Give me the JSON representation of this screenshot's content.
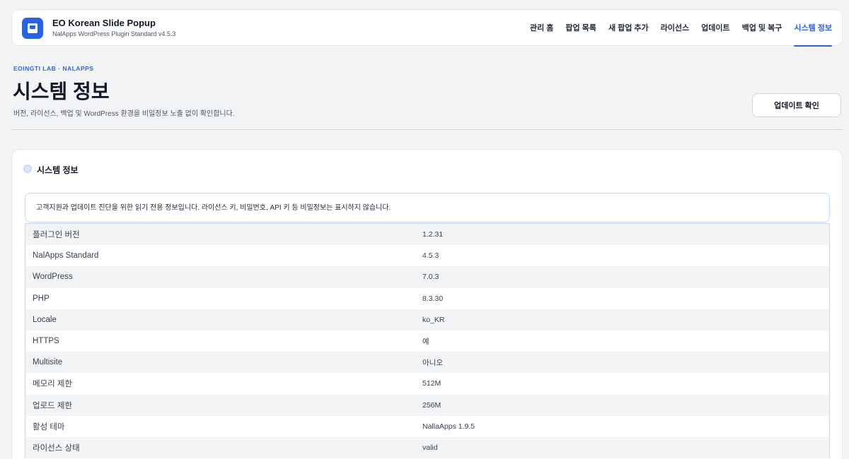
{
  "header": {
    "title": "EO Korean Slide Popup",
    "subtitle": "NalApps WordPress Plugin Standard v4.5.3",
    "logo_icon": "plugin-logo-icon",
    "nav": [
      {
        "label": "관리 홈",
        "active": false
      },
      {
        "label": "팝업 목록",
        "active": false
      },
      {
        "label": "새 팝업 추가",
        "active": false
      },
      {
        "label": "라이선스",
        "active": false
      },
      {
        "label": "업데이트",
        "active": false
      },
      {
        "label": "백업 및 복구",
        "active": false
      },
      {
        "label": "시스템 정보",
        "active": true
      }
    ]
  },
  "page": {
    "eyebrow": "EOINGTI LAB · NALAPPS",
    "title": "시스템 정보",
    "description": "버전, 라이선스, 백업 및 WordPress 환경을 비밀정보 노출 없이 확인합니다.",
    "check_update_label": "업데이트 확인"
  },
  "card": {
    "title": "시스템 정보",
    "notice": "고객지원과 업데이트 진단을 위한 읽기 전용 정보입니다. 라이선스 키, 비밀번호, API 키 등 비밀정보는 표시하지 않습니다.",
    "rows": [
      {
        "key": "플러그인 버전",
        "value": "1.2.31"
      },
      {
        "key": "NalApps Standard",
        "value": "4.5.3"
      },
      {
        "key": "WordPress",
        "value": "7.0.3"
      },
      {
        "key": "PHP",
        "value": "8.3.30"
      },
      {
        "key": "Locale",
        "value": "ko_KR"
      },
      {
        "key": "HTTPS",
        "value": "예"
      },
      {
        "key": "Multisite",
        "value": "아니오"
      },
      {
        "key": "메모리 제한",
        "value": "512M"
      },
      {
        "key": "업로드 제한",
        "value": "256M"
      },
      {
        "key": "활성 테마",
        "value": "NallaApps 1.9.5"
      },
      {
        "key": "라이선스 상태",
        "value": "valid"
      }
    ]
  },
  "colors": {
    "accent": "#2563eb",
    "background": "#f3f4f6",
    "notice_border": "#bfdbfe"
  }
}
